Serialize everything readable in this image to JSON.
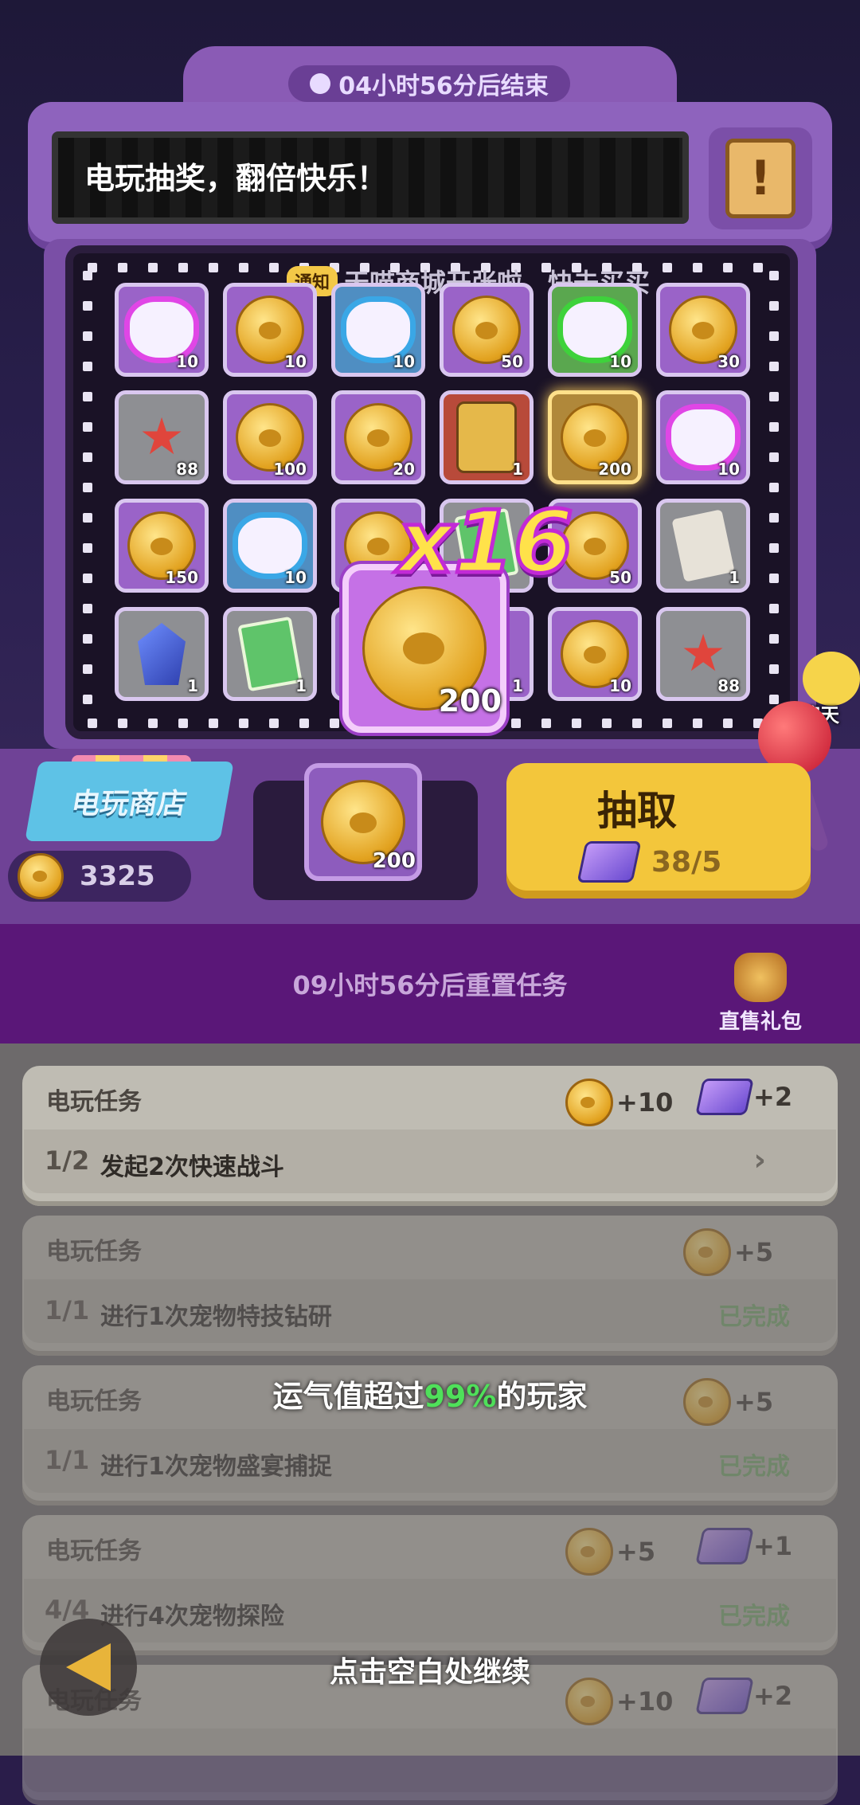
{
  "header": {
    "timer_text": "04小时56分后结束",
    "marquee_text": "电玩抽奖，翻倍快乐！",
    "notice_icon": "exclamation-scroll-icon"
  },
  "ticker": {
    "tag": "通知",
    "text": "天喵商城开张啦，快去买买"
  },
  "prize_grid": {
    "rows": [
      [
        {
          "item": "pink-glove",
          "count": "10"
        },
        {
          "item": "paw-coin",
          "count": "10"
        },
        {
          "item": "blue-glove",
          "count": "10"
        },
        {
          "item": "paw-coin",
          "count": "50"
        },
        {
          "item": "green-glove",
          "count": "10"
        },
        {
          "item": "paw-coin",
          "count": "30"
        }
      ],
      [
        {
          "item": "starfish",
          "count": "88"
        },
        {
          "item": "paw-coin",
          "count": "100"
        },
        {
          "item": "paw-coin",
          "count": "20"
        },
        {
          "item": "robot-pet",
          "count": "1"
        },
        {
          "item": "paw-coin",
          "count": "200"
        },
        {
          "item": "pink-glove",
          "count": "10"
        }
      ],
      [
        {
          "item": "paw-coin",
          "count": "150"
        },
        {
          "item": "blue-glove",
          "count": "10"
        },
        {
          "item": "paw-coin",
          "count": ""
        },
        {
          "item": "green-card",
          "count": ""
        },
        {
          "item": "paw-coin",
          "count": "50"
        },
        {
          "item": "paper-note",
          "count": "1"
        }
      ],
      [
        {
          "item": "blue-crystal",
          "count": "1"
        },
        {
          "item": "green-card",
          "count": "1"
        },
        {
          "item": "hidden",
          "count": ""
        },
        {
          "item": "hidden",
          "count": "1"
        },
        {
          "item": "paw-coin",
          "count": "10"
        },
        {
          "item": "starfish",
          "count": "88"
        }
      ]
    ]
  },
  "featured": {
    "item": "paw-coin",
    "count": "200",
    "multiplier": "x16"
  },
  "chat": {
    "label": "聊天"
  },
  "shop": {
    "label": "电玩商店",
    "balance": "3325"
  },
  "slot": {
    "item": "paw-coin",
    "count": "200"
  },
  "draw": {
    "label": "抽取",
    "cost": "38/5"
  },
  "task_band": {
    "reset_text": "09小时56分后重置任务",
    "gift_label": "直售礼包"
  },
  "tasks": [
    {
      "title": "电玩任务",
      "progress": "1/2",
      "desc": "发起2次快速战斗",
      "status": "",
      "rewards": [
        {
          "icon": "paw-coin",
          "amount": "+10"
        },
        {
          "icon": "ticket",
          "amount": "+2"
        }
      ]
    },
    {
      "title": "电玩任务",
      "progress": "1/1",
      "desc": "进行1次宠物特技钻研",
      "status": "已完成",
      "rewards": [
        {
          "icon": "paw-coin",
          "amount": "+5"
        }
      ]
    },
    {
      "title": "电玩任务",
      "progress": "1/1",
      "desc": "进行1次宠物盛宴捕捉",
      "status": "已完成",
      "rewards": [
        {
          "icon": "paw-coin",
          "amount": "+5"
        }
      ]
    },
    {
      "title": "电玩任务",
      "progress": "4/4",
      "desc": "进行4次宠物探险",
      "status": "已完成",
      "rewards": [
        {
          "icon": "paw-coin",
          "amount": "+5"
        },
        {
          "icon": "ticket",
          "amount": "+1"
        }
      ]
    },
    {
      "title": "电玩任务",
      "progress": "",
      "desc": "",
      "status": "",
      "rewards": [
        {
          "icon": "paw-coin",
          "amount": "+10"
        },
        {
          "icon": "ticket",
          "amount": "+2"
        }
      ]
    }
  ],
  "overlay": {
    "luck_prefix": "运气值超过",
    "luck_pct": "99%",
    "luck_suffix": "的玩家",
    "continue_text": "点击空白处继续"
  }
}
